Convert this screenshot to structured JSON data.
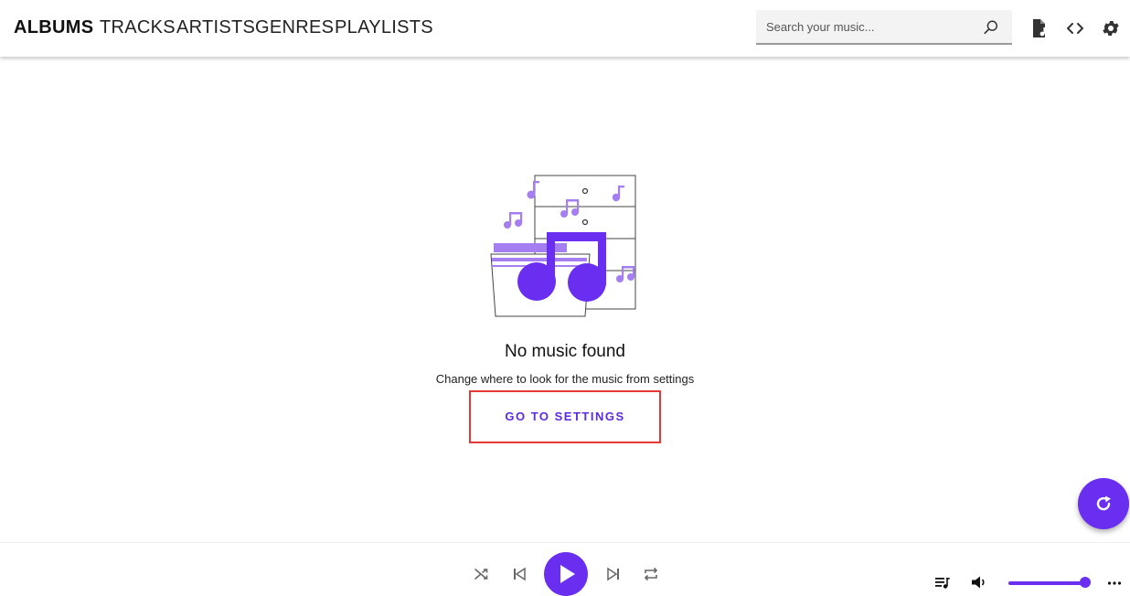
{
  "nav": {
    "tabs": [
      {
        "label": "ALBUMS",
        "active": true
      },
      {
        "label": "TRACKS",
        "active": false
      },
      {
        "label": "ARTISTS",
        "active": false
      },
      {
        "label": "GENRES",
        "active": false
      },
      {
        "label": "PLAYLISTS",
        "active": false
      }
    ]
  },
  "search": {
    "placeholder": "Search your music...",
    "value": "",
    "icon": "search-icon"
  },
  "top_actions": [
    {
      "icon": "file-music-icon"
    },
    {
      "icon": "code-icon"
    },
    {
      "icon": "gear-icon"
    }
  ],
  "empty_state": {
    "title": "No music found",
    "subtitle": "Change where to look for the music from settings",
    "button_label": "GO TO SETTINGS"
  },
  "fab": {
    "icon": "refresh-icon"
  },
  "player": {
    "controls": [
      "shuffle-icon",
      "previous-icon",
      "play-icon",
      "next-icon",
      "repeat-icon"
    ],
    "right": [
      "queue-icon",
      "volume-icon",
      "more-icon"
    ],
    "volume_level": 0.93
  },
  "colors": {
    "accent": "#6a2ef0",
    "accent_light": "#a57ff2",
    "highlight_border": "#e53935"
  }
}
